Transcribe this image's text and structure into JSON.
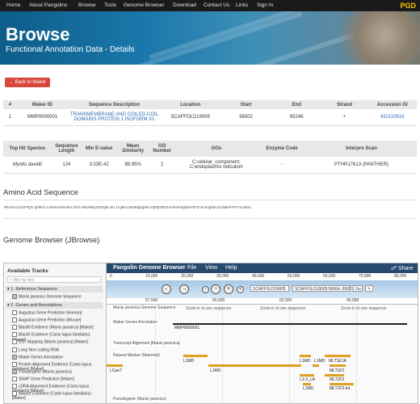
{
  "nav": {
    "items": [
      "Home",
      "About Pangolins",
      "Browse",
      "Tools",
      "Genome Browser",
      "Download",
      "Contact Us",
      "Links",
      "Sign In"
    ],
    "brand": "PGD"
  },
  "banner": {
    "title": "Browse",
    "subtitle": "Functional Annotation Data - Details"
  },
  "back_button": "Back to Maker",
  "maker_table": {
    "headers": [
      "#",
      "Maker ID",
      "Sequence Description",
      "Location",
      "Start",
      "End",
      "Strand",
      "Accession GI"
    ],
    "row": {
      "num": "1",
      "maker_id": "MMP0000001",
      "desc_line1": "TRANSMEMBRANE AND COILED-COIL",
      "desc_line2": "DOMAINS PROTEIN 1 ISOFORM X1",
      "location": "SCAFFOLD19005",
      "start": "56502",
      "end": "65246",
      "strand": "+",
      "accession": "432110916"
    }
  },
  "hit_table": {
    "headers": [
      "Top Hit Species",
      "Sequence Length",
      "Min E-value",
      "Mean Similarity",
      "GO Number",
      "GOs",
      "Enzyme Code",
      "Interpro Scan"
    ],
    "row": {
      "species": "Myotis davidii",
      "length": "124",
      "evalue": "3.03E-42",
      "similarity": "89.95%",
      "go_number": "2",
      "gos_line1": "C:cellular_component;",
      "gos_line2": "C:endoplasmic reticulum",
      "enzyme": "-",
      "interpro": "PTHR17613 (PANTHER)"
    }
  },
  "amino": {
    "heading": "Amino Acid Sequence",
    "sequence": "MPVAECVLESFPQFLQPDKTLLHVEKSVRAVRVLFKCFAREARKQTESEQRLSKLTLQNALENDNWQGQHRLFQPQCRRSSVSPHVVHQDDAPEPEYHLESQNSCAEVDWVPTHFTVLNHVL"
  },
  "genome": {
    "heading": "Genome Browser (JBrowse)",
    "tracks_header": "Available Tracks",
    "filter_placeholder": "filter by text",
    "cat1": "1. Reference Sequence",
    "ref_seq": "Manis javanica Genome Sequence",
    "cat2": "2. Genes and Annotations",
    "items": [
      "Augustus Gene Prediction [Human]",
      "Augustus Gene Prediction [Mouse]",
      "BlastN Evidence (Manis javanica) [Maker]",
      "BlastX Evidence (Canis lupus familiaris) [Maker]",
      "EST Mapping (Manis javanica) [Maker]",
      "Long Non-coding RNA",
      "Maker Genes Annotation",
      "Protein Alignment Evidence (Canis lupus familiaris) [Maker]",
      "Pseudogene (Manis javanica)",
      "SNAP Gene Prediction [Maker]",
      "cDNA Alignment Evidence (Canis lupus familiaris) [Maker]",
      "tBlastX Evidence (Canis lupus familiaris) [Maker]"
    ],
    "checked": [
      false,
      false,
      false,
      false,
      false,
      false,
      true,
      false,
      true,
      false,
      false,
      false
    ],
    "browser_title": "Pangolin Genome Browser",
    "menu": [
      "File",
      "View",
      "Help"
    ],
    "share": "Share",
    "ruler_ticks": [
      "0",
      "10,000",
      "20,000",
      "30,000",
      "40,000",
      "50,000",
      "60,000",
      "70,000",
      "80,000"
    ],
    "scale_ticks": [
      "57,500",
      "60,000",
      "62,500",
      "65,000"
    ],
    "ref_select": "SCAFFOLD19005",
    "loc_select": "SCAFFOLD19005:56064..65654 (9.59 Kb)",
    "go": "Go",
    "track_labels": {
      "seq": "Manis javanica Genome Sequence",
      "maker": "Maker Genes Annotation",
      "transcript": "Transcript Alignment [Manis javanica]",
      "repeat": "Repeat Masker (Mammal)",
      "pseudo": "Pseudogene (Manis javanica)"
    },
    "zoom_text": "Zoom in to see sequence",
    "gene_id": "MMP0000001",
    "features": [
      "L1MD",
      "L1MD",
      "L1MD",
      "MLT1E1A",
      "L1MD",
      "MLT1F2",
      "L1-3_LA",
      "MLT1F2",
      "MLT1F2-int",
      "L1MD",
      "L1MD",
      "LCan7"
    ]
  },
  "colors": {
    "accent": "#d9463d",
    "link": "#2a6bb0",
    "repeat": "#e0a020"
  }
}
